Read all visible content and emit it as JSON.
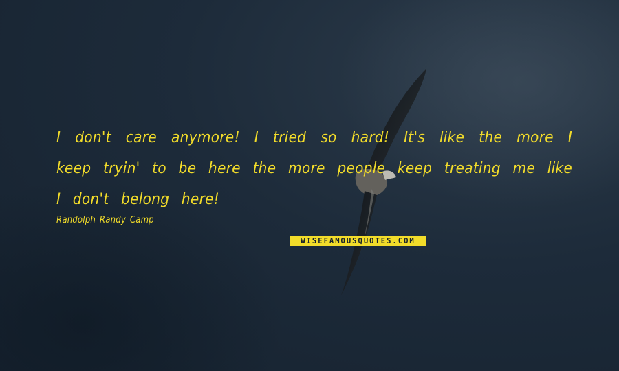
{
  "quote": {
    "text": "I don't care anymore! I tried so hard! It's like the more I keep tryin' to be here the more people keep treating me like I don't belong here!",
    "author": "Randolph Randy Camp"
  },
  "watermark": {
    "text": "WISEFAMOUSQUOTES.COM"
  },
  "colors": {
    "text": "#f2dc2a",
    "background": "#1d2b3a"
  }
}
